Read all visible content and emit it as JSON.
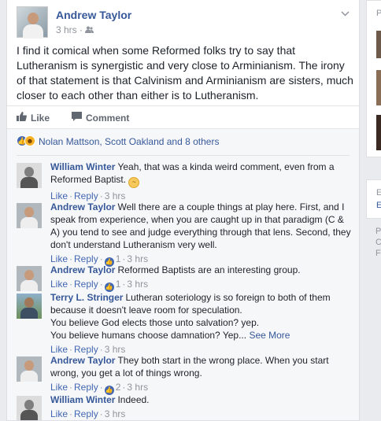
{
  "post": {
    "author": "Andrew Taylor",
    "time": "3 hrs",
    "privacy_icon": "friends-icon",
    "text": "I find it comical when some Reformed folks try to say that Lutheranism is synergistic and very close to Arminianism. The irony of that statement is that Calvinism and Arminianism are sisters, much closer to each other than either is to Lutheranism.",
    "actions": {
      "like": "Like",
      "comment": "Comment"
    }
  },
  "reactions": {
    "names": "Nolan Mattson, Scott Oakland and 8 others"
  },
  "footer": {
    "like": "Like",
    "reply": "Reply"
  },
  "comments": [
    {
      "author": "William Winter",
      "text": "Yeah, that was a kinda weird comment, even from a Reformed Baptist.",
      "emoji": "confused-face",
      "likes": "",
      "time": "3 hrs"
    },
    {
      "author": "Andrew Taylor",
      "text": "Well there are a couple things at play here. First, and I speak from experience, when you are caught up in that paradigm (C & A) you tend to see and judge everything through that lens. Second, they don't understand Lutheranism very well.",
      "likes": "1",
      "time": "3 hrs"
    },
    {
      "author": "Andrew Taylor",
      "text": "Reformed Baptists are an interesting group.",
      "likes": "1",
      "time": "3 hrs"
    },
    {
      "author": "Terry L. Stringer",
      "text": "Lutheran soteriology is so foreign to both of them because it doesn't leave room for speculation.",
      "line2": "You believe God elects those unto salvation? yep.",
      "line3": "You believe humans choose damnation? Yep...",
      "see_more": "See More",
      "likes": "",
      "time": "3 hrs"
    },
    {
      "author": "Andrew Taylor",
      "text": "They both start in the wrong place. When you start wrong, you get a lot of things wrong.",
      "likes": "2",
      "time": "3 hrs"
    },
    {
      "author": "William Winter",
      "text": "Indeed.",
      "likes": "",
      "time": "3 hrs"
    }
  ],
  "right_rail": {
    "letters": [
      "P",
      "E",
      "E",
      "P",
      "C",
      "F"
    ]
  }
}
